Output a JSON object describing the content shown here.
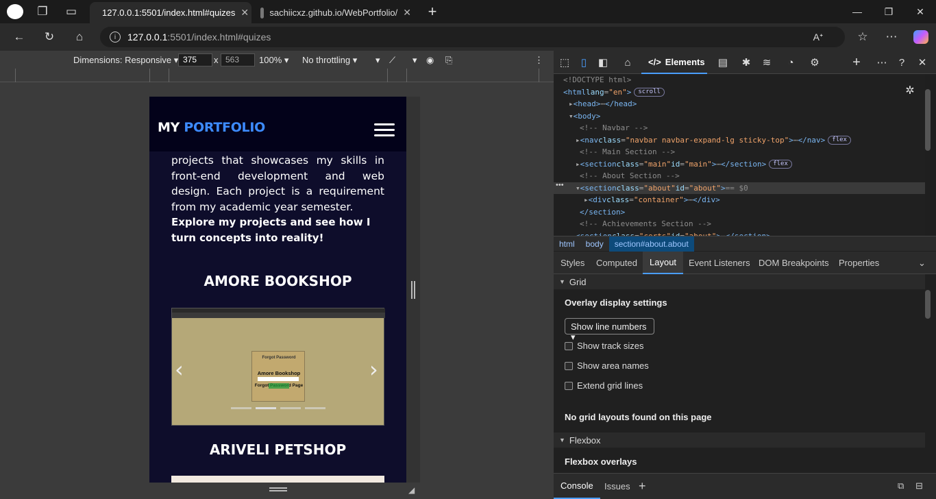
{
  "browser": {
    "tabs": [
      {
        "title": "127.0.0.1:5501/index.html#quizes",
        "active": true
      },
      {
        "title": "sachiicxz.github.io/WebPortfolio/",
        "active": false
      }
    ],
    "url_host": "127.0.0.1",
    "url_rest": ":5501/index.html#quizes",
    "new_tab": "+",
    "close": "✕"
  },
  "device_toolbar": {
    "dimensions": "Dimensions: Responsive",
    "width": "375",
    "times": "x",
    "height": "563",
    "zoom": "100%",
    "throttling": "No throttling"
  },
  "page": {
    "brand_my": "MY",
    "brand_portfolio": "PORTFOLIO",
    "paragraph": "projects that showcases my skills in front-end development and web design. Each project is a requirement from my academic year semester.",
    "bold": "Explore my projects and see how I turn concepts into reality!",
    "project1": "AMORE BOOKSHOP",
    "project2": "ARIVELI PETSHOP",
    "carousel_card": {
      "l1": "Forgot Password",
      "l2": "Amore Bookshop",
      "l3": "Forgot Password Page"
    },
    "prev": "‹",
    "next": "›"
  },
  "devtools": {
    "elements_tab": "Elements",
    "dom": [
      {
        "indent": 14,
        "html": "<span class='cm'>&lt;!DOCTYPE html&gt;</span>"
      },
      {
        "indent": 14,
        "html": "<span class='tg'>&lt;html</span> <span class='at'>lang</span>=<span class='av'>\"en\"</span><span class='tg'>&gt;</span><span class='pill'>scroll</span>"
      },
      {
        "indent": 22,
        "html": "▸ <span class='tg'>&lt;head&gt;</span>⋯<span class='tg'>&lt;/head&gt;</span>"
      },
      {
        "indent": 22,
        "html": "▾ <span class='tg'>&lt;body&gt;</span>"
      },
      {
        "indent": 38,
        "html": "<span class='cm'>&lt;!-- Navbar --&gt;</span>"
      },
      {
        "indent": 32,
        "html": "▸ <span class='tg'>&lt;nav</span> <span class='at'>class</span>=<span class='av'>\"navbar navbar-expand-lg sticky-top\"</span><span class='tg'>&gt;</span>⋯<span class='tg'>&lt;/nav&gt;</span><span class='pill'>flex</span>"
      },
      {
        "indent": 38,
        "html": "<span class='cm'>&lt;!-- Main Section --&gt;</span>"
      },
      {
        "indent": 32,
        "html": "▸ <span class='tg'>&lt;section</span> <span class='at'>class</span>=<span class='av'>\"main\"</span> <span class='at'>id</span>=<span class='av'>\"main\"</span><span class='tg'>&gt;</span>⋯<span class='tg'>&lt;/section&gt;</span><span class='pill'>flex</span>"
      },
      {
        "indent": 38,
        "html": "<span class='cm'>&lt;!--  About Section --&gt;</span>"
      },
      {
        "indent": 32,
        "html": "▾ <span class='tg'>&lt;section</span> <span class='at'>class</span>=<span class='av'>\"about\"</span> <span class='at'>id</span>=<span class='av'>\"about\"</span><span class='tg'>&gt;</span> <span class='cm'>== $0</span>"
      },
      {
        "indent": 44,
        "html": "▸ <span class='tg'>&lt;div</span> <span class='at'>class</span>=<span class='av'>\"container\"</span><span class='tg'>&gt;</span>⋯<span class='tg'>&lt;/div&gt;</span>"
      },
      {
        "indent": 38,
        "html": "<span class='tg'>&lt;/section&gt;</span>"
      },
      {
        "indent": 38,
        "html": "<span class='cm'>&lt;!--  Achievements Section --&gt;</span>"
      },
      {
        "indent": 32,
        "html": "<span class='tg'>&lt;section</span> <span class='at'>class</span>=<span class='av'>\"certs\"</span> <span class='at'>id</span>=<span class='av'>\"about\"</span><span class='tg'>&gt;</span>⋯<span class='tg'>&lt;/section&gt;</span>"
      }
    ],
    "breadcrumbs": [
      "html",
      "body",
      "section#about.about"
    ],
    "subtabs": [
      "Styles",
      "Computed",
      "Layout",
      "Event Listeners",
      "DOM Breakpoints",
      "Properties"
    ],
    "grid_header": "Grid",
    "overlay_settings": "Overlay display settings",
    "select_value": "Show line numbers",
    "checks": [
      "Show track sizes",
      "Show area names",
      "Extend grid lines"
    ],
    "no_grid": "No grid layouts found on this page",
    "flexbox_header": "Flexbox",
    "flexbox_overlays": "Flexbox overlays",
    "console_tabs": [
      "Console",
      "Issues"
    ]
  }
}
